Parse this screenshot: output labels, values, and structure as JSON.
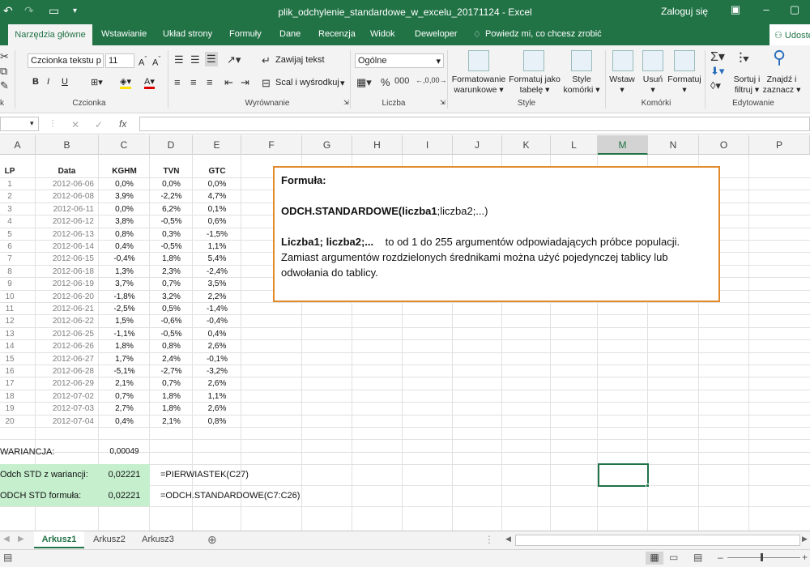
{
  "window": {
    "title": "plik_odchylenie_standardowe_w_excelu_20171124  -  Excel",
    "signin": "Zaloguj się",
    "share_label": "Udostępnij"
  },
  "tabs": [
    {
      "label": "Narzędzia główne",
      "active": true
    },
    {
      "label": "Wstawianie"
    },
    {
      "label": "Układ strony"
    },
    {
      "label": "Formuły"
    },
    {
      "label": "Dane"
    },
    {
      "label": "Recenzja"
    },
    {
      "label": "Widok"
    },
    {
      "label": "Deweloper"
    }
  ],
  "tell_me": "Powiedz mi, co chcesz zrobić",
  "ribbon": {
    "font_name": "Czcionka tekstu p",
    "font_size": "11",
    "wrap_text": "Zawijaj tekst",
    "merge_center": "Scal i wyśrodkuj",
    "number_format": "Ogólne",
    "cond_format": "Formatowanie warunkowe",
    "format_table": "Formatuj jako tabelę",
    "cell_styles": "Style komórki",
    "insert": "Wstaw",
    "delete": "Usuń",
    "format": "Formatuj",
    "sort_filter": "Sortuj i filtruj",
    "find_select": "Znajdź i zaznacz",
    "groups": {
      "font": "Czcionka",
      "alignment": "Wyrównanie",
      "number": "Liczba",
      "styles": "Style",
      "cells": "Komórki",
      "editing": "Edytowanie"
    }
  },
  "columns": [
    "A",
    "B",
    "C",
    "D",
    "E",
    "F",
    "G",
    "H",
    "I",
    "J",
    "K",
    "L",
    "M",
    "N",
    "O",
    "P"
  ],
  "selected_column": "M",
  "table": {
    "headers": [
      "LP",
      "Data",
      "KGHM",
      "TVN",
      "GTC"
    ],
    "rows": [
      [
        "1",
        "2012-06-06",
        "0,0%",
        "0,0%",
        "0,0%"
      ],
      [
        "2",
        "2012-06-08",
        "3,9%",
        "-2,2%",
        "4,7%"
      ],
      [
        "3",
        "2012-06-11",
        "0,0%",
        "6,2%",
        "0,1%"
      ],
      [
        "4",
        "2012-06-12",
        "3,8%",
        "-0,5%",
        "0,6%"
      ],
      [
        "5",
        "2012-06-13",
        "0,8%",
        "0,3%",
        "-1,5%"
      ],
      [
        "6",
        "2012-06-14",
        "0,4%",
        "-0,5%",
        "1,1%"
      ],
      [
        "7",
        "2012-06-15",
        "-0,4%",
        "1,8%",
        "5,4%"
      ],
      [
        "8",
        "2012-06-18",
        "1,3%",
        "2,3%",
        "-2,4%"
      ],
      [
        "9",
        "2012-06-19",
        "3,7%",
        "0,7%",
        "3,5%"
      ],
      [
        "10",
        "2012-06-20",
        "-1,8%",
        "3,2%",
        "2,2%"
      ],
      [
        "11",
        "2012-06-21",
        "-2,5%",
        "0,5%",
        "-1,4%"
      ],
      [
        "12",
        "2012-06-22",
        "1,5%",
        "-0,6%",
        "-0,4%"
      ],
      [
        "13",
        "2012-06-25",
        "-1,1%",
        "-0,5%",
        "0,4%"
      ],
      [
        "14",
        "2012-06-26",
        "1,8%",
        "0,8%",
        "2,6%"
      ],
      [
        "15",
        "2012-06-27",
        "1,7%",
        "2,4%",
        "-0,1%"
      ],
      [
        "16",
        "2012-06-28",
        "-5,1%",
        "-2,7%",
        "-3,2%"
      ],
      [
        "17",
        "2012-06-29",
        "2,1%",
        "0,7%",
        "2,6%"
      ],
      [
        "18",
        "2012-07-02",
        "0,7%",
        "1,8%",
        "1,1%"
      ],
      [
        "19",
        "2012-07-03",
        "2,7%",
        "1,8%",
        "2,6%"
      ],
      [
        "20",
        "2012-07-04",
        "0,4%",
        "2,1%",
        "0,8%"
      ]
    ]
  },
  "summary": {
    "variance_label": "WARIANCJA:",
    "variance_value": "0,00049",
    "std_var_label": "Odch STD z wariancji:",
    "std_var_value": "0,02221",
    "std_var_formula": "=PIERWIASTEK(C27)",
    "std_formula_label": "ODCH STD formuła:",
    "std_formula_value": "0,02221",
    "std_formula_text": "=ODCH.STANDARDOWE(C7:C26)"
  },
  "note": {
    "heading": "Formuła:",
    "func_name": "ODCH.STANDARDOWE(",
    "func_arg1": "liczba1",
    "func_rest": ";liczba2;...)",
    "args_label": "Liczba1; liczba2;...",
    "args_desc": "to od 1 do 255 argumentów odpowiadających próbce populacji. Zamiast argumentów rozdzielonych średnikami można użyć pojedynczej tablicy lub odwołania do tablicy."
  },
  "sheets": [
    "Arkusz1",
    "Arkusz2",
    "Arkusz3"
  ],
  "active_sheet": "Arkusz1",
  "colors": {
    "excel_green": "#217346",
    "selection_green": "#c6efce",
    "note_border": "#e28a2b"
  }
}
